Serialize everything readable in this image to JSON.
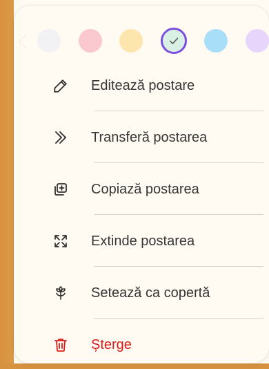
{
  "swatches": [
    {
      "name": "white",
      "color": "#f2f2f4",
      "selected": false
    },
    {
      "name": "pink",
      "color": "#f9c9cf",
      "selected": false
    },
    {
      "name": "yellow",
      "color": "#fde6ad",
      "selected": false
    },
    {
      "name": "green",
      "color": "#d9f0e5",
      "selected": true
    },
    {
      "name": "blue",
      "color": "#a9def8",
      "selected": false
    },
    {
      "name": "purple",
      "color": "#e8d5fb",
      "selected": false
    }
  ],
  "menu": {
    "items": [
      {
        "label": "Editează postare",
        "icon": "pencil-icon"
      },
      {
        "label": "Transferă postarea",
        "icon": "double-chevron-right-icon"
      },
      {
        "label": "Copiază postarea",
        "icon": "copy-add-icon"
      },
      {
        "label": "Extinde postarea",
        "icon": "expand-icon"
      },
      {
        "label": "Setează ca copertă",
        "icon": "flower-icon"
      },
      {
        "label": "Șterge",
        "icon": "trash-icon"
      }
    ]
  },
  "colors": {
    "accent": "#7c4dde",
    "danger": "#d91c17",
    "backdrop": "#d8913f",
    "menu_background": "#fffaf2"
  }
}
